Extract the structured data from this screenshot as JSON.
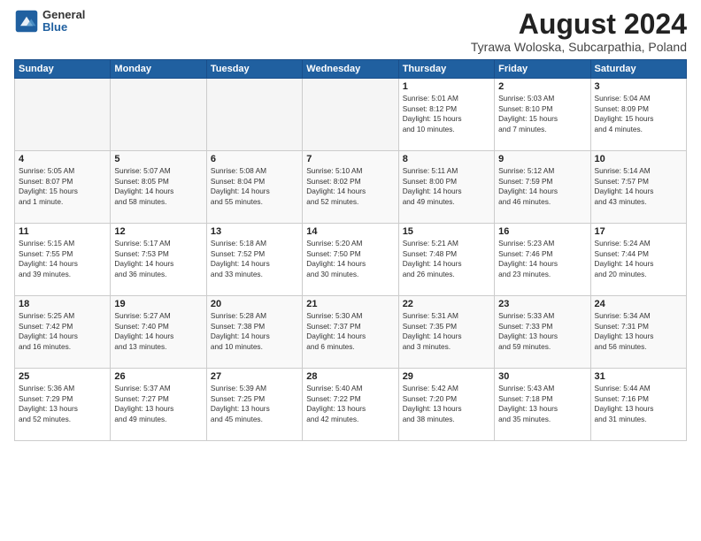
{
  "logo": {
    "general": "General",
    "blue": "Blue"
  },
  "title": "August 2024",
  "location": "Tyrawa Woloska, Subcarpathia, Poland",
  "days_of_week": [
    "Sunday",
    "Monday",
    "Tuesday",
    "Wednesday",
    "Thursday",
    "Friday",
    "Saturday"
  ],
  "weeks": [
    [
      {
        "day": "",
        "info": ""
      },
      {
        "day": "",
        "info": ""
      },
      {
        "day": "",
        "info": ""
      },
      {
        "day": "",
        "info": ""
      },
      {
        "day": "1",
        "info": "Sunrise: 5:01 AM\nSunset: 8:12 PM\nDaylight: 15 hours\nand 10 minutes."
      },
      {
        "day": "2",
        "info": "Sunrise: 5:03 AM\nSunset: 8:10 PM\nDaylight: 15 hours\nand 7 minutes."
      },
      {
        "day": "3",
        "info": "Sunrise: 5:04 AM\nSunset: 8:09 PM\nDaylight: 15 hours\nand 4 minutes."
      }
    ],
    [
      {
        "day": "4",
        "info": "Sunrise: 5:05 AM\nSunset: 8:07 PM\nDaylight: 15 hours\nand 1 minute."
      },
      {
        "day": "5",
        "info": "Sunrise: 5:07 AM\nSunset: 8:05 PM\nDaylight: 14 hours\nand 58 minutes."
      },
      {
        "day": "6",
        "info": "Sunrise: 5:08 AM\nSunset: 8:04 PM\nDaylight: 14 hours\nand 55 minutes."
      },
      {
        "day": "7",
        "info": "Sunrise: 5:10 AM\nSunset: 8:02 PM\nDaylight: 14 hours\nand 52 minutes."
      },
      {
        "day": "8",
        "info": "Sunrise: 5:11 AM\nSunset: 8:00 PM\nDaylight: 14 hours\nand 49 minutes."
      },
      {
        "day": "9",
        "info": "Sunrise: 5:12 AM\nSunset: 7:59 PM\nDaylight: 14 hours\nand 46 minutes."
      },
      {
        "day": "10",
        "info": "Sunrise: 5:14 AM\nSunset: 7:57 PM\nDaylight: 14 hours\nand 43 minutes."
      }
    ],
    [
      {
        "day": "11",
        "info": "Sunrise: 5:15 AM\nSunset: 7:55 PM\nDaylight: 14 hours\nand 39 minutes."
      },
      {
        "day": "12",
        "info": "Sunrise: 5:17 AM\nSunset: 7:53 PM\nDaylight: 14 hours\nand 36 minutes."
      },
      {
        "day": "13",
        "info": "Sunrise: 5:18 AM\nSunset: 7:52 PM\nDaylight: 14 hours\nand 33 minutes."
      },
      {
        "day": "14",
        "info": "Sunrise: 5:20 AM\nSunset: 7:50 PM\nDaylight: 14 hours\nand 30 minutes."
      },
      {
        "day": "15",
        "info": "Sunrise: 5:21 AM\nSunset: 7:48 PM\nDaylight: 14 hours\nand 26 minutes."
      },
      {
        "day": "16",
        "info": "Sunrise: 5:23 AM\nSunset: 7:46 PM\nDaylight: 14 hours\nand 23 minutes."
      },
      {
        "day": "17",
        "info": "Sunrise: 5:24 AM\nSunset: 7:44 PM\nDaylight: 14 hours\nand 20 minutes."
      }
    ],
    [
      {
        "day": "18",
        "info": "Sunrise: 5:25 AM\nSunset: 7:42 PM\nDaylight: 14 hours\nand 16 minutes."
      },
      {
        "day": "19",
        "info": "Sunrise: 5:27 AM\nSunset: 7:40 PM\nDaylight: 14 hours\nand 13 minutes."
      },
      {
        "day": "20",
        "info": "Sunrise: 5:28 AM\nSunset: 7:38 PM\nDaylight: 14 hours\nand 10 minutes."
      },
      {
        "day": "21",
        "info": "Sunrise: 5:30 AM\nSunset: 7:37 PM\nDaylight: 14 hours\nand 6 minutes."
      },
      {
        "day": "22",
        "info": "Sunrise: 5:31 AM\nSunset: 7:35 PM\nDaylight: 14 hours\nand 3 minutes."
      },
      {
        "day": "23",
        "info": "Sunrise: 5:33 AM\nSunset: 7:33 PM\nDaylight: 13 hours\nand 59 minutes."
      },
      {
        "day": "24",
        "info": "Sunrise: 5:34 AM\nSunset: 7:31 PM\nDaylight: 13 hours\nand 56 minutes."
      }
    ],
    [
      {
        "day": "25",
        "info": "Sunrise: 5:36 AM\nSunset: 7:29 PM\nDaylight: 13 hours\nand 52 minutes."
      },
      {
        "day": "26",
        "info": "Sunrise: 5:37 AM\nSunset: 7:27 PM\nDaylight: 13 hours\nand 49 minutes."
      },
      {
        "day": "27",
        "info": "Sunrise: 5:39 AM\nSunset: 7:25 PM\nDaylight: 13 hours\nand 45 minutes."
      },
      {
        "day": "28",
        "info": "Sunrise: 5:40 AM\nSunset: 7:22 PM\nDaylight: 13 hours\nand 42 minutes."
      },
      {
        "day": "29",
        "info": "Sunrise: 5:42 AM\nSunset: 7:20 PM\nDaylight: 13 hours\nand 38 minutes."
      },
      {
        "day": "30",
        "info": "Sunrise: 5:43 AM\nSunset: 7:18 PM\nDaylight: 13 hours\nand 35 minutes."
      },
      {
        "day": "31",
        "info": "Sunrise: 5:44 AM\nSunset: 7:16 PM\nDaylight: 13 hours\nand 31 minutes."
      }
    ]
  ]
}
